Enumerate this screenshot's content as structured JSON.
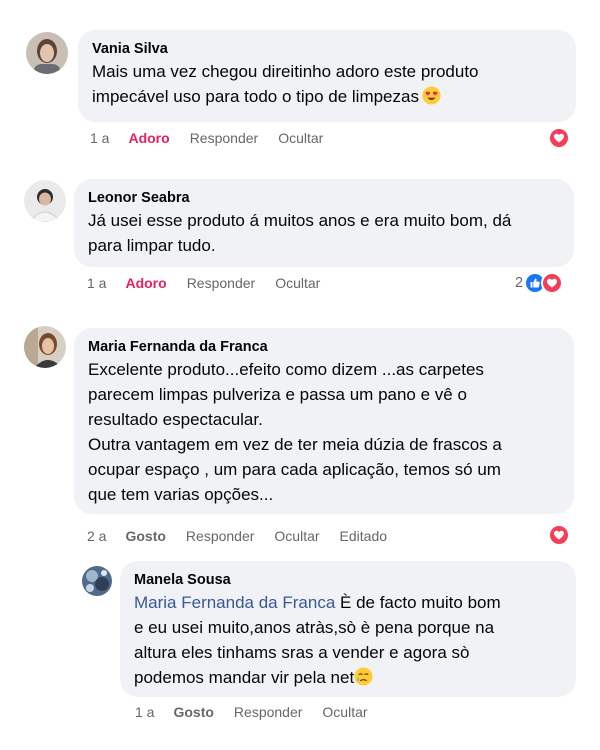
{
  "colors": {
    "bubble": "#f0f2f5",
    "love": "#f33e58",
    "like": "#1877f2",
    "adoro": "#e0245e",
    "mention": "#385898",
    "meta": "#65676b"
  },
  "comments": [
    {
      "author": "Vania Silva",
      "lines": [
        "Mais uma vez chegou direitinho adoro este produto",
        "impecável uso para todo o tipo de limpezas"
      ],
      "emoji": "heart-eyes-emoji",
      "actions": {
        "time": "1 a",
        "reaction": "Adoro",
        "reply": "Responder",
        "hide": "Ocultar"
      },
      "reactions": {
        "count": "",
        "icons": [
          "love"
        ]
      }
    },
    {
      "author": "Leonor Seabra",
      "lines": [
        "Já usei esse produto á muitos anos e era muito bom, dá",
        "para limpar tudo."
      ],
      "actions": {
        "time": "1 a",
        "reaction": "Adoro",
        "reply": "Responder",
        "hide": "Ocultar"
      },
      "reactions": {
        "count": "2",
        "icons": [
          "like",
          "love"
        ]
      }
    },
    {
      "author": "Maria Fernanda da Franca",
      "lines": [
        "Excelente produto...efeito como dizem ...as carpetes",
        "parecem limpas pulveriza e passa um pano e vê o",
        "resultado espectacular.",
        "Outra vantagem em vez de ter meia dúzia de frascos a",
        "ocupar espaço , um para cada aplicação, temos só um",
        "que tem varias opções..."
      ],
      "actions": {
        "time": "2 a",
        "reaction": "Gosto",
        "reply": "Responder",
        "hide": "Ocultar",
        "edited": "Editado"
      },
      "reactions": {
        "count": "",
        "icons": [
          "love"
        ]
      }
    }
  ],
  "reply": {
    "author": "Manela Sousa",
    "mention": "Maria Fernanda da Franca",
    "line1_rest": " È de facto muito bom",
    "lines": [
      "e eu usei muito,anos atràs,sò è pena porque na",
      "altura eles tinhams sras a vender e agora sò"
    ],
    "last_line": "podemos mandar vir pela net",
    "emoji": "crying-emoji",
    "actions": {
      "time": "1 a",
      "reaction": "Gosto",
      "reply": "Responder",
      "hide": "Ocultar"
    }
  }
}
